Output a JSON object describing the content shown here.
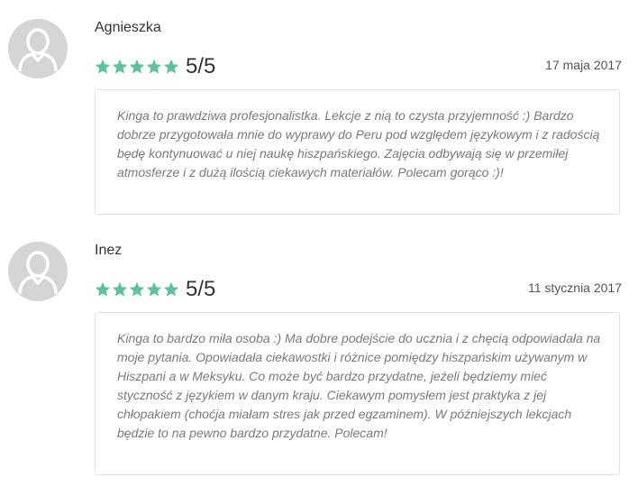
{
  "reviews": [
    {
      "name": "Agnieszka",
      "score": "5/5",
      "rating": 5,
      "date": "17 maja 2017",
      "text": "Kinga to prawdziwa profesjonalistka. Lekcje z nią to czysta przyjemność :) Bardzo dobrze przygotowała mnie do wyprawy do Peru pod względem językowym i z radością będę kontynuować u niej naukę hiszpańskiego. Zajęcia odbywają się w przemiłej atmosferze i z dużą ilością ciekawych materiałów. Polecam gorąco :)!"
    },
    {
      "name": "Inez",
      "score": "5/5",
      "rating": 5,
      "date": "11 stycznia 2017",
      "text": "Kinga to bardzo miła osoba :) Ma dobre podejście do ucznia i z chęcią odpowiadała na moje pytania. Opowiadała ciekawostki i różnice pomiędzy hiszpańskim używanym w Hiszpani a w Meksyku. Co może być bardzo przydatne, jeżeli będziemy mieć styczność z językiem w danym kraju. Ciekawym pomysłem jest praktyka z jej chłopakiem (choćja miałam stres jak przed egzaminem). W późniejszych lekcjach będzie to na pewno bardzo przydatne. Polecam!"
    }
  ],
  "colors": {
    "star": "#5cc49c",
    "avatar_bg": "#d5d5d5",
    "avatar_fg": "#ffffff"
  },
  "icons": {
    "avatar": "user-silhouette-icon",
    "star": "star-icon"
  }
}
